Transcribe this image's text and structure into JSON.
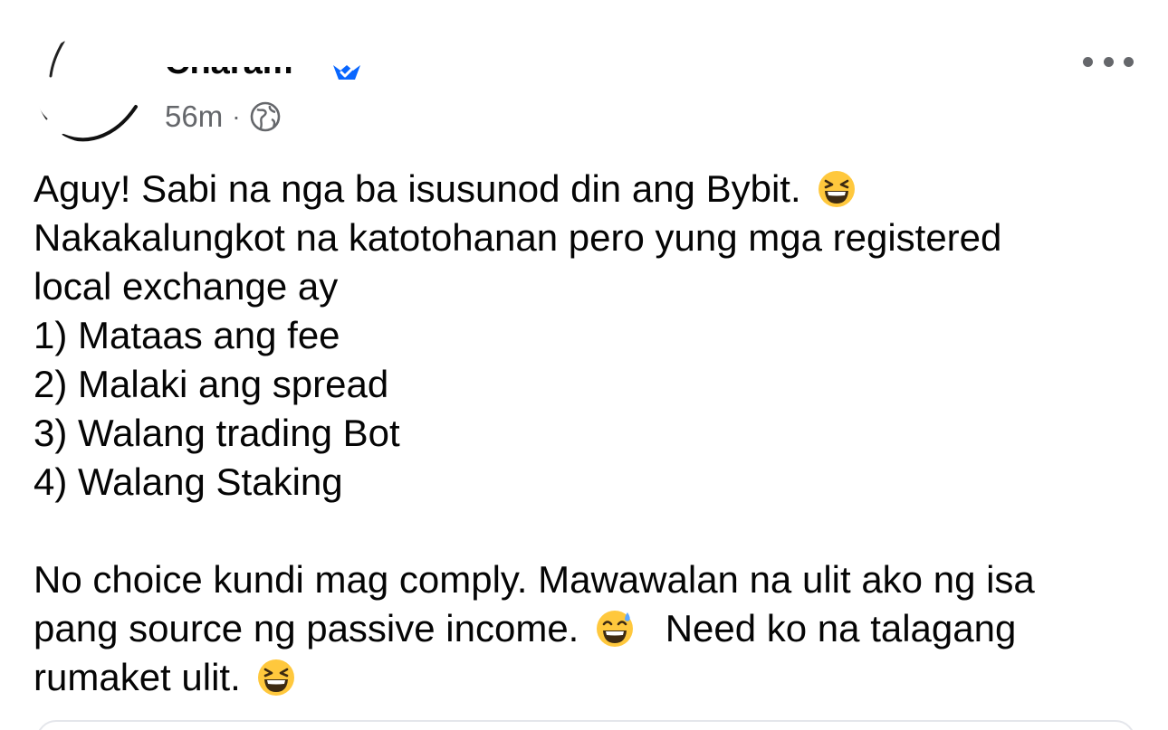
{
  "post": {
    "author": {
      "name": "Charam",
      "verified": true
    },
    "timestamp": "56m",
    "separator": "·",
    "audience_icon": "globe-icon",
    "more_icon": "more-options-icon",
    "lines": [
      "Aguy! Sabi na nga ba isusunod din ang Bybit.",
      "Nakakalungkot na katotohanan pero yung mga registered",
      "local exchange ay",
      "1) Mataas ang fee",
      "2) Malaki ang spread",
      "3) Walang trading Bot",
      "4) Walang Staking",
      "No choice kundi mag comply. Mawawalan na ulit ako ng isa",
      "pang source ng passive income.",
      "Need ko na talagang",
      "rumaket ulit."
    ],
    "emojis": {
      "laughing": "laughing-squint-emoji",
      "sweat_smile": "sweat-smile-emoji"
    }
  },
  "colors": {
    "text": "#050505",
    "secondary_text": "#65676b",
    "verified_badge": "#0866ff",
    "emoji_yellow": "#ffc83d"
  }
}
